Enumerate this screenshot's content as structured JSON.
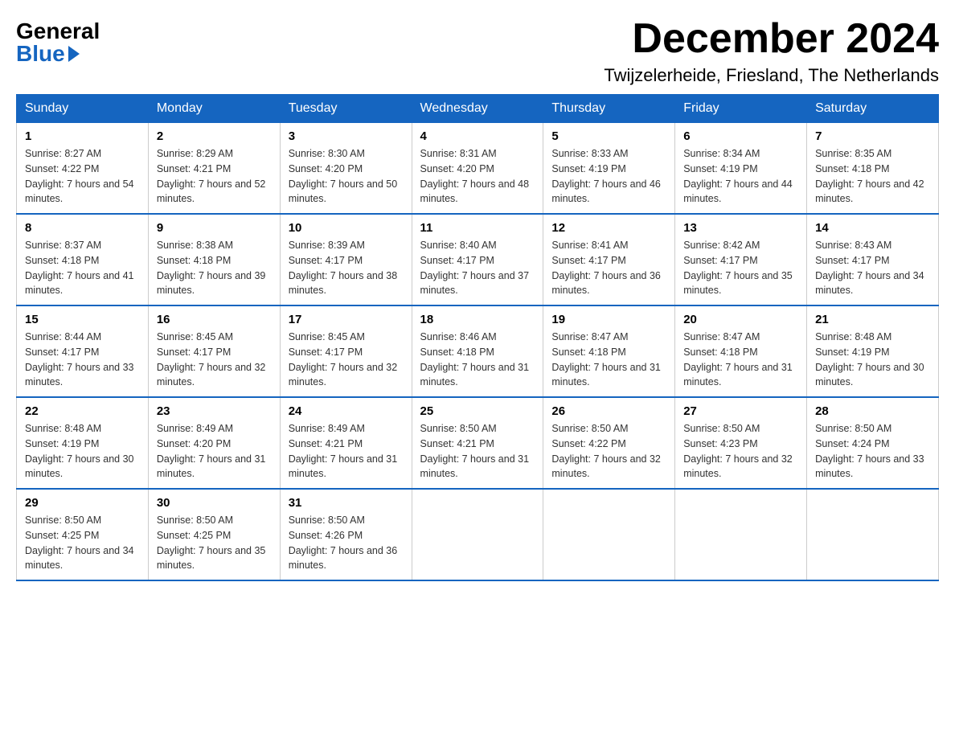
{
  "logo": {
    "general": "General",
    "blue": "Blue"
  },
  "header": {
    "month_year": "December 2024",
    "location": "Twijzelerheide, Friesland, The Netherlands"
  },
  "weekdays": [
    "Sunday",
    "Monday",
    "Tuesday",
    "Wednesday",
    "Thursday",
    "Friday",
    "Saturday"
  ],
  "weeks": [
    [
      {
        "day": "1",
        "sunrise": "8:27 AM",
        "sunset": "4:22 PM",
        "daylight": "7 hours and 54 minutes."
      },
      {
        "day": "2",
        "sunrise": "8:29 AM",
        "sunset": "4:21 PM",
        "daylight": "7 hours and 52 minutes."
      },
      {
        "day": "3",
        "sunrise": "8:30 AM",
        "sunset": "4:20 PM",
        "daylight": "7 hours and 50 minutes."
      },
      {
        "day": "4",
        "sunrise": "8:31 AM",
        "sunset": "4:20 PM",
        "daylight": "7 hours and 48 minutes."
      },
      {
        "day": "5",
        "sunrise": "8:33 AM",
        "sunset": "4:19 PM",
        "daylight": "7 hours and 46 minutes."
      },
      {
        "day": "6",
        "sunrise": "8:34 AM",
        "sunset": "4:19 PM",
        "daylight": "7 hours and 44 minutes."
      },
      {
        "day": "7",
        "sunrise": "8:35 AM",
        "sunset": "4:18 PM",
        "daylight": "7 hours and 42 minutes."
      }
    ],
    [
      {
        "day": "8",
        "sunrise": "8:37 AM",
        "sunset": "4:18 PM",
        "daylight": "7 hours and 41 minutes."
      },
      {
        "day": "9",
        "sunrise": "8:38 AM",
        "sunset": "4:18 PM",
        "daylight": "7 hours and 39 minutes."
      },
      {
        "day": "10",
        "sunrise": "8:39 AM",
        "sunset": "4:17 PM",
        "daylight": "7 hours and 38 minutes."
      },
      {
        "day": "11",
        "sunrise": "8:40 AM",
        "sunset": "4:17 PM",
        "daylight": "7 hours and 37 minutes."
      },
      {
        "day": "12",
        "sunrise": "8:41 AM",
        "sunset": "4:17 PM",
        "daylight": "7 hours and 36 minutes."
      },
      {
        "day": "13",
        "sunrise": "8:42 AM",
        "sunset": "4:17 PM",
        "daylight": "7 hours and 35 minutes."
      },
      {
        "day": "14",
        "sunrise": "8:43 AM",
        "sunset": "4:17 PM",
        "daylight": "7 hours and 34 minutes."
      }
    ],
    [
      {
        "day": "15",
        "sunrise": "8:44 AM",
        "sunset": "4:17 PM",
        "daylight": "7 hours and 33 minutes."
      },
      {
        "day": "16",
        "sunrise": "8:45 AM",
        "sunset": "4:17 PM",
        "daylight": "7 hours and 32 minutes."
      },
      {
        "day": "17",
        "sunrise": "8:45 AM",
        "sunset": "4:17 PM",
        "daylight": "7 hours and 32 minutes."
      },
      {
        "day": "18",
        "sunrise": "8:46 AM",
        "sunset": "4:18 PM",
        "daylight": "7 hours and 31 minutes."
      },
      {
        "day": "19",
        "sunrise": "8:47 AM",
        "sunset": "4:18 PM",
        "daylight": "7 hours and 31 minutes."
      },
      {
        "day": "20",
        "sunrise": "8:47 AM",
        "sunset": "4:18 PM",
        "daylight": "7 hours and 31 minutes."
      },
      {
        "day": "21",
        "sunrise": "8:48 AM",
        "sunset": "4:19 PM",
        "daylight": "7 hours and 30 minutes."
      }
    ],
    [
      {
        "day": "22",
        "sunrise": "8:48 AM",
        "sunset": "4:19 PM",
        "daylight": "7 hours and 30 minutes."
      },
      {
        "day": "23",
        "sunrise": "8:49 AM",
        "sunset": "4:20 PM",
        "daylight": "7 hours and 31 minutes."
      },
      {
        "day": "24",
        "sunrise": "8:49 AM",
        "sunset": "4:21 PM",
        "daylight": "7 hours and 31 minutes."
      },
      {
        "day": "25",
        "sunrise": "8:50 AM",
        "sunset": "4:21 PM",
        "daylight": "7 hours and 31 minutes."
      },
      {
        "day": "26",
        "sunrise": "8:50 AM",
        "sunset": "4:22 PM",
        "daylight": "7 hours and 32 minutes."
      },
      {
        "day": "27",
        "sunrise": "8:50 AM",
        "sunset": "4:23 PM",
        "daylight": "7 hours and 32 minutes."
      },
      {
        "day": "28",
        "sunrise": "8:50 AM",
        "sunset": "4:24 PM",
        "daylight": "7 hours and 33 minutes."
      }
    ],
    [
      {
        "day": "29",
        "sunrise": "8:50 AM",
        "sunset": "4:25 PM",
        "daylight": "7 hours and 34 minutes."
      },
      {
        "day": "30",
        "sunrise": "8:50 AM",
        "sunset": "4:25 PM",
        "daylight": "7 hours and 35 minutes."
      },
      {
        "day": "31",
        "sunrise": "8:50 AM",
        "sunset": "4:26 PM",
        "daylight": "7 hours and 36 minutes."
      },
      null,
      null,
      null,
      null
    ]
  ]
}
